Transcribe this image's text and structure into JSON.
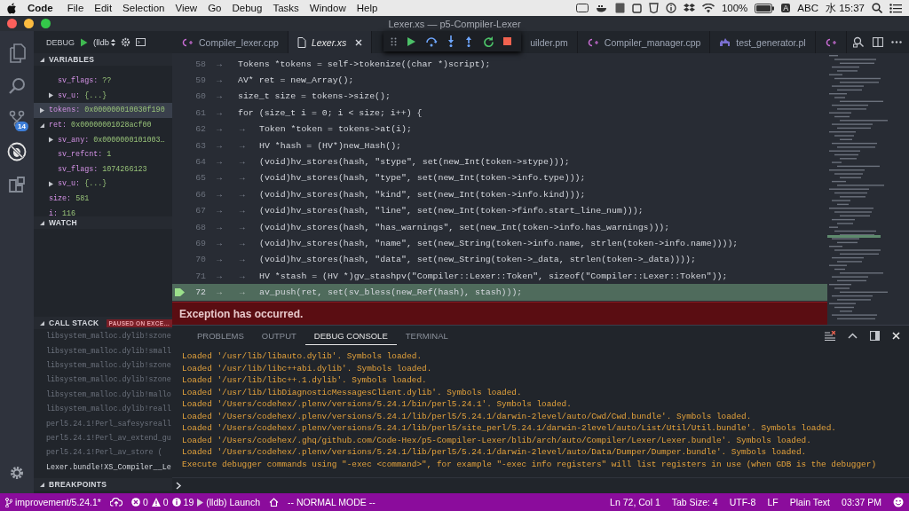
{
  "menubar": {
    "app": "Code",
    "menus": [
      "File",
      "Edit",
      "Selection",
      "View",
      "Go",
      "Debug",
      "Tasks",
      "Window",
      "Help"
    ],
    "battery": "100%",
    "input_letter": "A",
    "input_source": "ABC",
    "clock": "水 15:37"
  },
  "window": {
    "title": "Lexer.xs — p5-Compiler-Lexer"
  },
  "activity_bar": {
    "scm_badge": "14",
    "items": [
      {
        "kind": "explorer",
        "selected": false
      },
      {
        "kind": "search",
        "selected": false
      },
      {
        "kind": "scm",
        "selected": false
      },
      {
        "kind": "debug",
        "selected": true
      },
      {
        "kind": "extensions",
        "selected": false
      }
    ]
  },
  "debug_bar": {
    "label": "DEBUG",
    "configuration": "(lldb"
  },
  "variables": {
    "title": "VARIABLES",
    "expanded": true,
    "items": [
      {
        "children": [
          {
            "name": "sv_flags:",
            "value": "??",
            "selected": false
          },
          {
            "name": "sv_u:",
            "value": "{...}",
            "expanded": false,
            "selected": false
          }
        ]
      },
      {
        "name": "tokens:",
        "value": "0x000000010030f190",
        "expanded": false,
        "selected": true
      },
      {
        "name": "ret:",
        "value": "0x00000001028acf00",
        "expanded": true,
        "selected": false,
        "children": [
          {
            "name": "sv_any:",
            "value": "0x0000000101003…",
            "expanded": false,
            "selected": false
          },
          {
            "name": "sv_refcnt:",
            "value": "1",
            "selected": false
          },
          {
            "name": "sv_flags:",
            "value": "1074266123",
            "selected": false
          },
          {
            "name": "sv_u:",
            "value": "{...}",
            "expanded": false,
            "selected": false
          }
        ]
      },
      {
        "name": "size:",
        "value": "581",
        "selected": false
      },
      {
        "name": "i:",
        "value": "116",
        "selected": false
      }
    ]
  },
  "watch": {
    "title": "WATCH",
    "expanded": true
  },
  "call_stack": {
    "title": "CALL STACK",
    "expanded": true,
    "badge": "PAUSED ON EXCE…",
    "frames": [
      {
        "label": "libsystem_malloc.dylib!szone",
        "dimmed": true
      },
      {
        "label": "libsystem_malloc.dylib!small",
        "dimmed": true
      },
      {
        "label": "libsystem_malloc.dylib!szone",
        "dimmed": true
      },
      {
        "label": "libsystem_malloc.dylib!szone",
        "dimmed": true
      },
      {
        "label": "libsystem_malloc.dylib!mallo",
        "dimmed": true
      },
      {
        "label": "libsystem_malloc.dylib!reall",
        "dimmed": true
      },
      {
        "label": "perl5.24.1!Perl_safesysreall",
        "dimmed": true
      },
      {
        "label": "perl5.24.1!Perl_av_extend_gu",
        "dimmed": true
      },
      {
        "label": "perl5.24.1!Perl_av_store (",
        "dimmed": true
      },
      {
        "label": "Lexer.bundle!XS_Compiler__Le",
        "dimmed": false
      }
    ]
  },
  "breakpoints": {
    "title": "BREAKPOINTS",
    "expanded": true
  },
  "tabs": [
    {
      "kind": "cpp",
      "label": "Compiler_lexer.cpp",
      "selected": false
    },
    {
      "kind": "file",
      "label": "Lexer.xs",
      "selected": true
    },
    {
      "label": "uilder.pm",
      "selected": false
    },
    {
      "kind": "cpp",
      "label": "Compiler_manager.cpp",
      "selected": false
    },
    {
      "kind": "perl",
      "label": "test_generator.pl",
      "selected": false
    },
    {
      "kind": "cpp",
      "selected": false
    }
  ],
  "debug_toolbar": {
    "buttons": [
      {
        "kind": "continue"
      },
      {
        "kind": "step_over"
      },
      {
        "kind": "step_into"
      },
      {
        "kind": "step_out"
      },
      {
        "kind": "restart"
      },
      {
        "kind": "stop"
      }
    ]
  },
  "lines": [
    {
      "number": "58",
      "indent": "→",
      "text": "Tokens *tokens = self->tokenize((char *)script);",
      "current": false
    },
    {
      "number": "59",
      "indent": "→",
      "text": "AV* ret  = new_Array();",
      "current": false
    },
    {
      "number": "60",
      "indent": "→",
      "text": "size_t size = tokens->size();",
      "current": false
    },
    {
      "number": "61",
      "indent": "→",
      "text": "for (size_t i = 0; i < size; i++) {",
      "current": false
    },
    {
      "number": "62",
      "indent": "→ →",
      "text": "Token *token = tokens->at(i);",
      "current": false
    },
    {
      "number": "63",
      "indent": "→ →",
      "text": "HV *hash = (HV*)new_Hash();",
      "current": false
    },
    {
      "number": "64",
      "indent": "→ →",
      "text": "(void)hv_stores(hash, \"stype\", set(new_Int(token->stype)));",
      "current": false
    },
    {
      "number": "65",
      "indent": "→ →",
      "text": "(void)hv_stores(hash, \"type\", set(new_Int(token->info.type)));",
      "current": false
    },
    {
      "number": "66",
      "indent": "→ →",
      "text": "(void)hv_stores(hash, \"kind\", set(new_Int(token->info.kind)));",
      "current": false
    },
    {
      "number": "67",
      "indent": "→ →",
      "text": "(void)hv_stores(hash, \"line\", set(new_Int(token->finfo.start_line_num)));",
      "current": false
    },
    {
      "number": "68",
      "indent": "→ →",
      "text": "(void)hv_stores(hash, \"has_warnings\", set(new_Int(token->info.has_warnings)));",
      "current": false
    },
    {
      "number": "69",
      "indent": "→ →",
      "text": "(void)hv_stores(hash, \"name\", set(new_String(token->info.name, strlen(token->info.name))));",
      "current": false
    },
    {
      "number": "70",
      "indent": "→ →",
      "text": "(void)hv_stores(hash, \"data\", set(new_String(token->_data, strlen(token->_data))));",
      "current": false
    },
    {
      "number": "71",
      "indent": "→ →",
      "text": "HV *stash = (HV *)gv_stashpv(\"Compiler::Lexer::Token\", sizeof(\"Compiler::Lexer::Token\"));",
      "current": false
    },
    {
      "number": "72",
      "indent": "→ →",
      "text": "av_push(ret, set(sv_bless(new_Ref(hash), stash)));",
      "current": true
    }
  ],
  "exception": {
    "message": "Exception has occurred."
  },
  "panel": {
    "tabs": [
      {
        "label": "PROBLEMS",
        "selected": false
      },
      {
        "label": "OUTPUT",
        "selected": false
      },
      {
        "label": "DEBUG CONSOLE",
        "selected": true
      },
      {
        "label": "TERMINAL",
        "selected": false
      }
    ],
    "console": [
      "Loaded '/usr/lib/libauto.dylib'. Symbols loaded.",
      "Loaded '/usr/lib/libc++abi.dylib'. Symbols loaded.",
      "Loaded '/usr/lib/libc++.1.dylib'. Symbols loaded.",
      "Loaded '/usr/lib/libDiagnosticMessagesClient.dylib'. Symbols loaded.",
      "Loaded '/Users/codehex/.plenv/versions/5.24.1/bin/perl5.24.1'. Symbols loaded.",
      "Loaded '/Users/codehex/.plenv/versions/5.24.1/lib/perl5/5.24.1/darwin-2level/auto/Cwd/Cwd.bundle'. Symbols loaded.",
      "Loaded '/Users/codehex/.plenv/versions/5.24.1/lib/perl5/site_perl/5.24.1/darwin-2level/auto/List/Util/Util.bundle'. Symbols loaded.",
      "Loaded '/Users/codehex/.ghq/github.com/Code-Hex/p5-Compiler-Lexer/blib/arch/auto/Compiler/Lexer/Lexer.bundle'. Symbols loaded.",
      "Loaded '/Users/codehex/.plenv/versions/5.24.1/lib/perl5/5.24.1/darwin-2level/auto/Data/Dumper/Dumper.bundle'. Symbols loaded.",
      "Execute debugger commands using \"-exec <command>\", for example \"-exec info registers\" will list registers in use (when GDB is the debugger)"
    ]
  },
  "status_bar": {
    "left": [
      {
        "kind": "branch",
        "text": "improvement/5.24.1*"
      },
      {
        "kind": "sync"
      },
      {
        "kind": "errors",
        "text": "0"
      },
      {
        "kind": "warnings",
        "text": "0"
      },
      {
        "kind": "info",
        "text": "19"
      },
      {
        "kind": "launch",
        "text": "(lldb) Launch"
      },
      {
        "kind": "home"
      },
      {
        "kind": "text",
        "text": "-- NORMAL MODE --"
      }
    ],
    "right": [
      "Ln 72, Col 1",
      "Tab Size: 4",
      "UTF-8",
      "LF",
      "Plain Text",
      "03:37 PM"
    ]
  }
}
